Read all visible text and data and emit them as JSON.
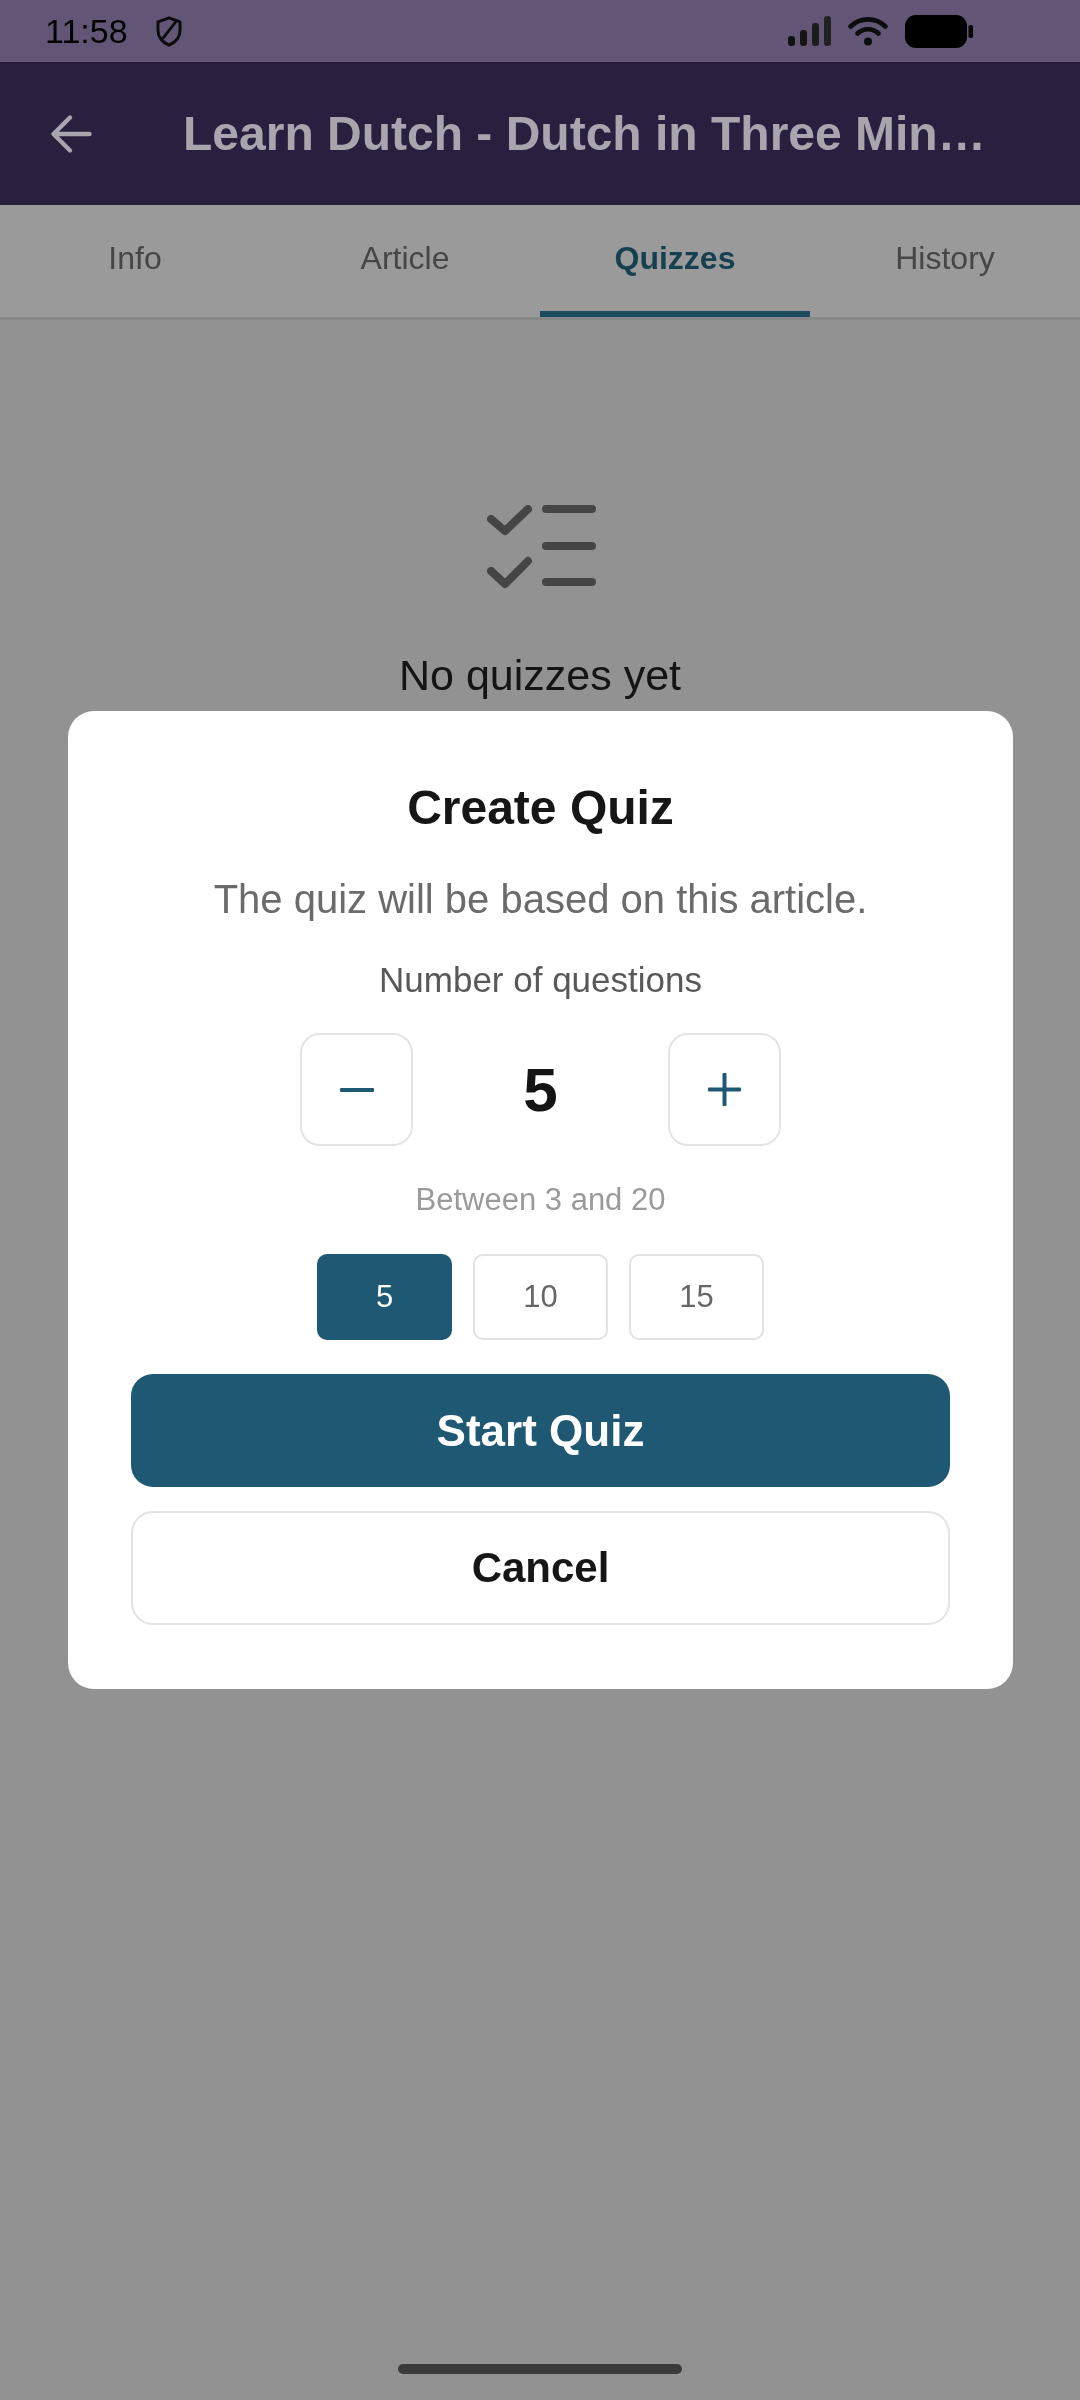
{
  "status_bar": {
    "time": "11:58"
  },
  "app_bar": {
    "title": "Learn Dutch - Dutch in Three Min…"
  },
  "tabs": [
    {
      "label": "Info",
      "selected": false
    },
    {
      "label": "Article",
      "selected": false
    },
    {
      "label": "Quizzes",
      "selected": true
    },
    {
      "label": "History",
      "selected": false
    }
  ],
  "empty_state": {
    "message": "No quizzes yet"
  },
  "dialog": {
    "title": "Create Quiz",
    "subtitle": "The quiz will be based on this article.",
    "count_label": "Number of questions",
    "count_value": "5",
    "range_hint": "Between 3 and 20",
    "presets": [
      {
        "label": "5",
        "selected": true
      },
      {
        "label": "10",
        "selected": false
      },
      {
        "label": "15",
        "selected": false
      }
    ],
    "buttons": [
      {
        "label": "Start Quiz",
        "kind": "primary"
      },
      {
        "label": "Cancel",
        "kind": "secondary"
      }
    ]
  }
}
